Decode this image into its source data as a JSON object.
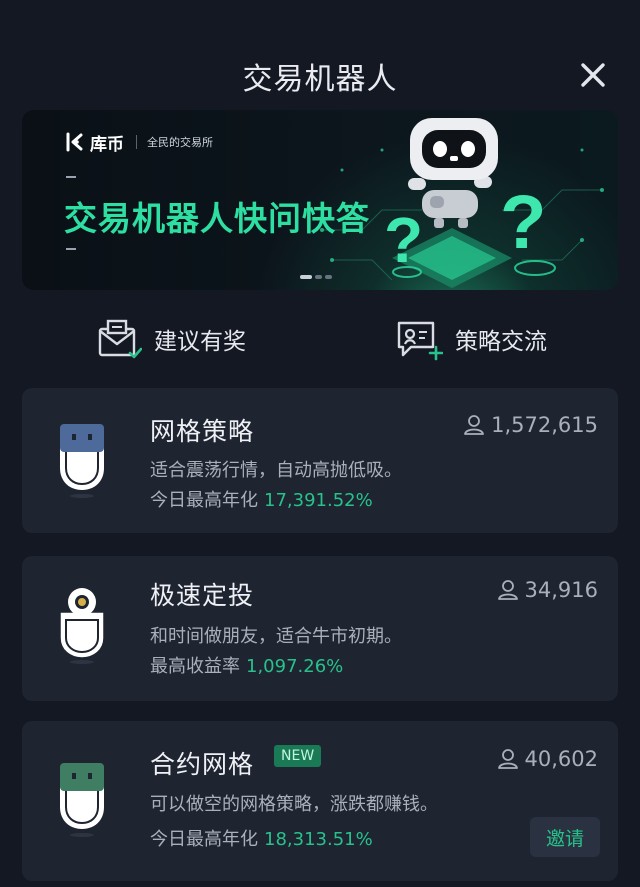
{
  "header": {
    "title": "交易机器人",
    "close_icon": "close-icon"
  },
  "banner": {
    "brand_name": "库币",
    "brand_slogan": "全民的交易所",
    "headline": "交易机器人快问快答",
    "accent_color": "#2de0a2",
    "active_slide": 1,
    "slide_count": 3
  },
  "links": [
    {
      "label": "建议有奖",
      "icon": "suggestion-envelope-icon"
    },
    {
      "label": "策略交流",
      "icon": "chat-plus-icon"
    }
  ],
  "cards": [
    {
      "title": "网格策略",
      "users": "1,572,615",
      "description": "适合震荡行情，自动高抛低吸。",
      "stat_label": "今日最高年化",
      "stat_value": "17,391.52%",
      "robot_color": "#4d6a9a"
    },
    {
      "title": "极速定投",
      "users": "34,916",
      "description": "和时间做朋友，适合牛市初期。",
      "stat_label": "最高收益率",
      "stat_value": "1,097.26%",
      "robot_color": "#f5f6f8"
    },
    {
      "title": "合约网格",
      "badge": "NEW",
      "users": "40,602",
      "description": "可以做空的网格策略，涨跌都赚钱。",
      "stat_label": "今日最高年化",
      "stat_value": "18,313.51%",
      "invite_label": "邀请",
      "robot_color": "#3f7e62"
    }
  ],
  "colors": {
    "background": "#141823",
    "card": "#1f2431",
    "positive": "#27c28b"
  }
}
